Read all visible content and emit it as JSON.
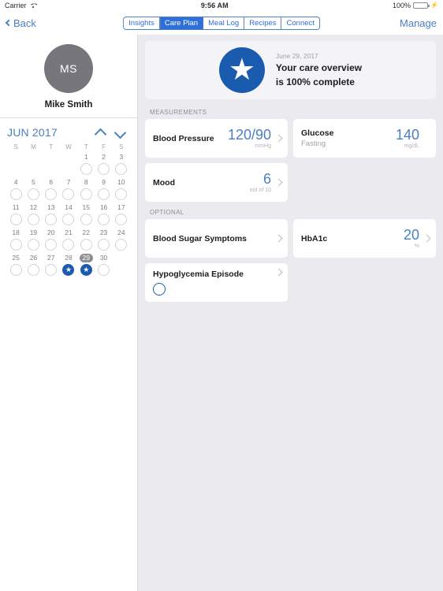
{
  "statusbar": {
    "carrier": "Carrier",
    "wifi_icon": "wifi-icon",
    "time": "9:56 AM",
    "battery_percent": "100%",
    "battery_icon": "battery-icon",
    "charging_icon": "lightning-bolt-icon"
  },
  "navbar": {
    "back_label": "Back",
    "back_icon": "chevron-left-icon",
    "manage_label": "Manage",
    "segments": [
      {
        "label": "Insights",
        "active": false
      },
      {
        "label": "Care Plan",
        "active": true
      },
      {
        "label": "Meal Log",
        "active": false
      },
      {
        "label": "Recipes",
        "active": false
      },
      {
        "label": "Connect",
        "active": false
      }
    ]
  },
  "sidebar": {
    "profile": {
      "initials": "MS",
      "name": "Mike Smith"
    },
    "calendar": {
      "title": "JUN 2017",
      "prev_icon": "chevron-up-icon",
      "next_icon": "chevron-down-icon",
      "weekdays": [
        "S",
        "M",
        "T",
        "W",
        "T",
        "F",
        "S"
      ],
      "selected_day": 29,
      "starred_days": [
        28,
        29
      ],
      "days": [
        null,
        null,
        null,
        null,
        1,
        2,
        3,
        4,
        5,
        6,
        7,
        8,
        9,
        10,
        11,
        12,
        13,
        14,
        15,
        16,
        17,
        18,
        19,
        20,
        21,
        22,
        23,
        24,
        25,
        26,
        27,
        28,
        29,
        30,
        null
      ]
    }
  },
  "main": {
    "hero": {
      "star_icon": "star-icon",
      "date": "June 29, 2017",
      "title_line1": "Your care overview",
      "title_line2": "is 100% complete"
    },
    "sections": [
      {
        "label": "MEASUREMENTS",
        "rows": [
          [
            {
              "name": "blood-pressure",
              "label": "Blood Pressure",
              "sub": "",
              "value": "120/90",
              "unit": "mmHg",
              "chevron": true,
              "ring": false
            },
            {
              "name": "glucose",
              "label": "Glucose",
              "sub": "Fasting",
              "value": "140",
              "unit": "mg/dL",
              "chevron": false,
              "ring": false
            }
          ],
          [
            {
              "name": "mood",
              "label": "Mood",
              "sub": "",
              "value": "6",
              "unit": "out of 10",
              "chevron": true,
              "ring": false
            },
            {
              "name": "empty",
              "empty": true
            }
          ]
        ]
      },
      {
        "label": "OPTIONAL",
        "rows": [
          [
            {
              "name": "blood-sugar-symptoms",
              "label": "Blood Sugar Symptoms",
              "sub": "",
              "value": "",
              "unit": "",
              "chevron": true,
              "ring": false
            },
            {
              "name": "hba1c",
              "label": "HbA1c",
              "sub": "",
              "value": "20",
              "unit": "%",
              "chevron": true,
              "ring": false
            }
          ],
          [
            {
              "name": "hypoglycemia-episode",
              "label": "Hypoglycemia Episode",
              "sub": "",
              "value": "",
              "unit": "",
              "chevron": true,
              "ring": true
            },
            {
              "name": "empty",
              "empty": true
            }
          ]
        ]
      }
    ]
  },
  "colors": {
    "accent_blue": "#4a7fc1",
    "segment_blue": "#2e6fd9",
    "deep_blue": "#1a5bb0",
    "bg_gray": "#eaeaef",
    "avatar_gray": "#77767c",
    "battery_green": "#4cd464"
  }
}
